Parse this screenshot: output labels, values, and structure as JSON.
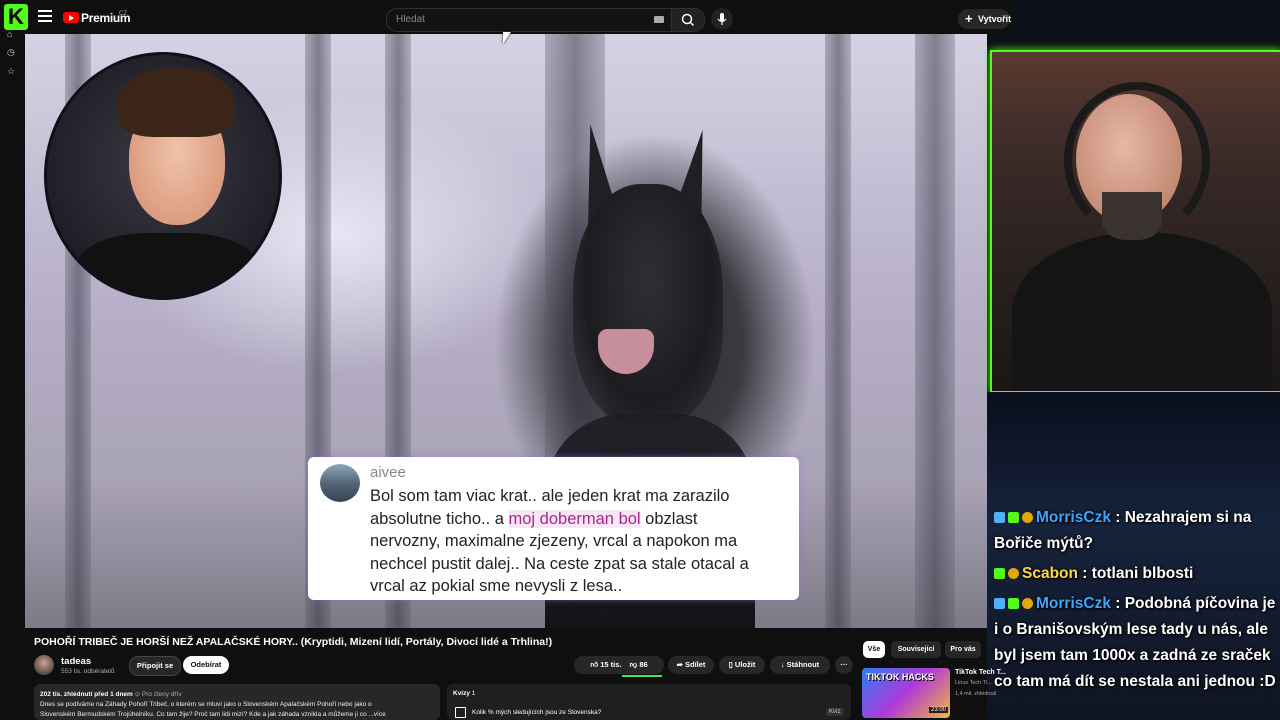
{
  "header": {
    "logo_letter": "K",
    "brand": "Premium",
    "region": "CZ",
    "search_placeholder": "Hledat",
    "create_label": "Vytvořit"
  },
  "video": {
    "comment": {
      "user": "aivee",
      "lines": [
        {
          "pre": "Bol som tam viac krat.. ale jeden krat ma zarazilo",
          "hl": "",
          "post": ""
        },
        {
          "pre": "absolutne ticho.. a ",
          "hl": "moj doberman bol",
          "post": " obzlast"
        },
        {
          "pre": "nervozny, maximalne zjezeny, vrcal a napokon ma",
          "hl": "",
          "post": ""
        },
        {
          "pre": "nechcel pustit dalej.. Na ceste zpat sa stale otacal a",
          "hl": "",
          "post": ""
        },
        {
          "pre": "vrcal az pokial sme nevysli z lesa..",
          "hl": "",
          "post": ""
        }
      ]
    }
  },
  "chat": [
    {
      "badges": [
        "cube",
        "bot",
        "gold"
      ],
      "user": "MorrisCzk",
      "user_color": "#3ea6ff",
      "text": ": Nezahrajem si na Bořiče mýtů?"
    },
    {
      "badges": [
        "bot",
        "gold"
      ],
      "user": "Scabon",
      "user_color": "#ffd84a",
      "text": ": totlani blbosti"
    },
    {
      "badges": [
        "cube",
        "bot",
        "gold"
      ],
      "user": "MorrisCzk",
      "user_color": "#3ea6ff",
      "text": ": Podobná píčovina je i o Branišovským lese tady u nás, ale byl jsem tam 1000x a zadná ze sraček co tam má dít se nestala ani jednou :D"
    }
  ],
  "watch": {
    "title": "POHOŘÍ TRIBEČ JE HORŠÍ NEŽ APALAČSKÉ HORY.. (Kryptidi, Mizení lidí, Portály, Divocí lidé a Trhlina!)",
    "channel": "tadeas",
    "subscribers": "553 tis. odběratelů",
    "join_label": "Připojit se",
    "subscribe_label": "Odebírat",
    "likes": "15 tis.",
    "dislikes": "86",
    "share_label": "Sdílet",
    "save_label": "Uložit",
    "download_label": "Stáhnout",
    "more_label": "···",
    "views_line": "202 tis. zhlédnutí  před 1 dnem",
    "members_tag": "Pro členy dřív",
    "desc_line1": "Dnes se podíváme na Záhady Pohoří Tribeč, o kterém se mluví jako o Slovenském Apalačském Pohoří nebo jako o",
    "desc_line2": "Slovenském Bermudském Trojúhelníku. Co tam žije? Proč tam lidi mizí? Kde a jak záhada vznikla a můžeme ji co ...více",
    "quiz_title": "Kvízy",
    "quiz_count": "1",
    "quiz_question": "Kolik % mých sledujících jsou ze Slovenska?",
    "quiz_tag": "Kvíz"
  },
  "sidebar_chips": [
    "Vše",
    "Související",
    "Pro vás"
  ],
  "recommended": {
    "thumb_text": "TIKTOK HACKS",
    "duration": "23:00",
    "title": "TikTok Tech T...",
    "channel": "Linus Tech Ti...",
    "views": "1,4 mil. zhlédnutí"
  }
}
